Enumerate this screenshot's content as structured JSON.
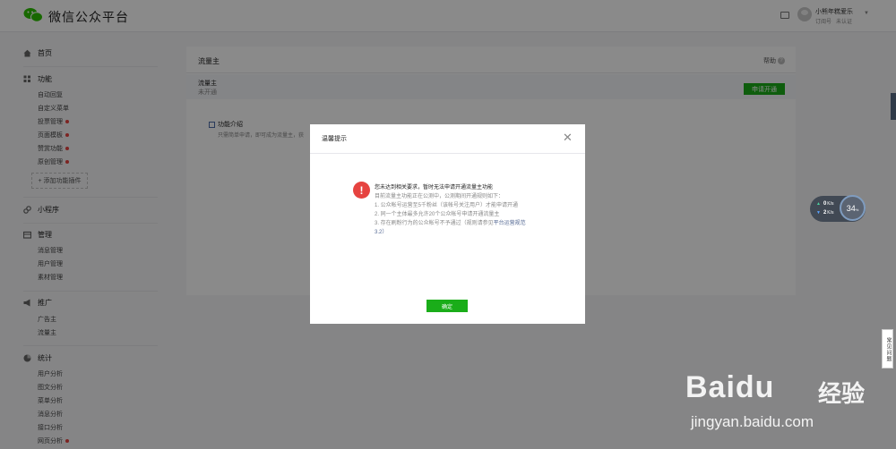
{
  "header": {
    "brand": "微信公众平台",
    "user_name": "小熊年糕爱乐",
    "user_type": "订阅号",
    "user_status": "未认证"
  },
  "sidebar": {
    "home": "首页",
    "features": {
      "label": "功能",
      "items": [
        {
          "label": "自动回复",
          "dot": false
        },
        {
          "label": "自定义菜单",
          "dot": false
        },
        {
          "label": "投票管理",
          "dot": true
        },
        {
          "label": "页面模板",
          "dot": true
        },
        {
          "label": "赞赏功能",
          "dot": true
        },
        {
          "label": "原创管理",
          "dot": true
        }
      ],
      "add_plugin": "添加功能插件"
    },
    "mini_program": "小程序",
    "manage": {
      "label": "管理",
      "items": [
        "消息管理",
        "用户管理",
        "素材管理"
      ]
    },
    "promote": {
      "label": "推广",
      "items": [
        "广告主",
        "流量主"
      ]
    },
    "stats": {
      "label": "统计",
      "items": [
        {
          "label": "用户分析",
          "dot": false
        },
        {
          "label": "图文分析",
          "dot": false
        },
        {
          "label": "菜单分析",
          "dot": false
        },
        {
          "label": "消息分析",
          "dot": false
        },
        {
          "label": "接口分析",
          "dot": false
        },
        {
          "label": "网页分析",
          "dot": true
        }
      ]
    }
  },
  "main": {
    "title": "流量主",
    "help": "帮助",
    "status_name": "流量主",
    "status_value": "未开通",
    "apply_button": "申请开通",
    "intro_title": "功能介绍",
    "intro_desc": "只需简单申请，即可成为流量主，获"
  },
  "dialog": {
    "title": "温馨提示",
    "message_main": "您未达到相关要求，暂时无法申请开通流量主功能",
    "line1": "目前流量主功能正在公测中，公测期间开通规则如下：",
    "line2": "1. 公众帐号运营至5千粉丝（该帐号关注用户）才能申请开通",
    "line3": "2. 同一个主体最多允许20个公众帐号申请开通流量主",
    "line4_prefix": "3. 存在刷粉行为的公众帐号不予通过（规则请参见",
    "line4_link": "平台运营规范",
    "line5": "3.2）",
    "confirm_button": "确定"
  },
  "speed_widget": {
    "upload_value": "0",
    "upload_unit": "K/s",
    "download_value": "2",
    "download_unit": "K/s",
    "percent": "34",
    "percent_unit": "%"
  },
  "faq_tab": "常见问题",
  "watermark": {
    "brand": "Baidu",
    "product": "经验",
    "url": "jingyan.baidu.com"
  },
  "colors": {
    "accent_green": "#1aad19",
    "alert_red": "#e64340",
    "link_blue": "#576b95"
  },
  "icons": [
    "wechat-logo-icon",
    "mail-icon",
    "home-icon",
    "grid-icon",
    "link-icon",
    "folder-icon",
    "megaphone-icon",
    "chart-icon",
    "help-icon",
    "warning-icon",
    "close-icon"
  ]
}
